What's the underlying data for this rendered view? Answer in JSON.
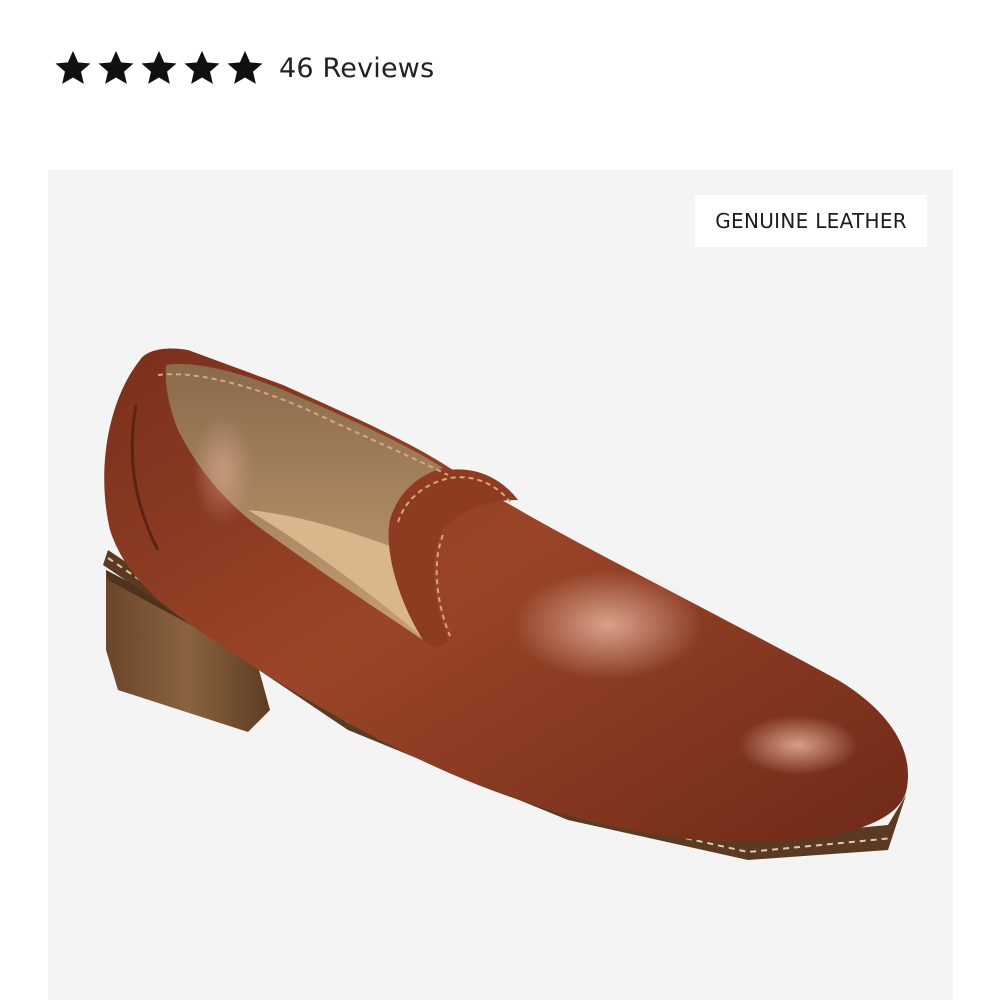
{
  "rating": {
    "stars": 5,
    "max_stars": 5,
    "reviews_label": "46 Reviews"
  },
  "product_image": {
    "badge": "GENUINE LEATHER",
    "colors": {
      "background": "#f4f4f4",
      "leather": "#8a3a22",
      "heel": "#7a5234"
    }
  }
}
